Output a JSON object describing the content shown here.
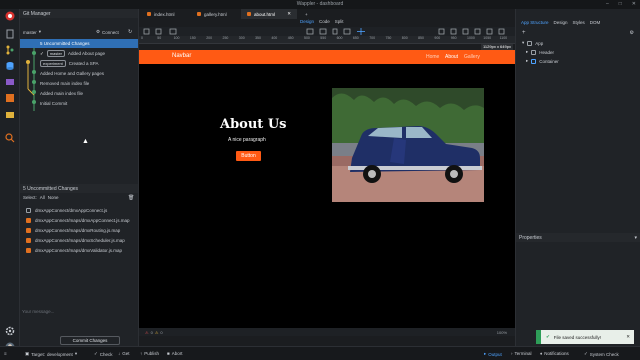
{
  "titlebar": {
    "title": "Wappler - dashboard"
  },
  "git": {
    "panel_title": "Git Manager",
    "branch": "master",
    "connect_label": "Connect",
    "uncommitted_label": "5 Uncommitted Changes",
    "commits": [
      {
        "tag": "master",
        "message": "Added About page"
      },
      {
        "tag": "experiment",
        "message": "Created a SPA"
      },
      {
        "tag": "",
        "message": "Added Home and Gallery pages"
      },
      {
        "tag": "",
        "message": "Removed main index file"
      },
      {
        "tag": "",
        "message": "Added main index file"
      },
      {
        "tag": "",
        "message": "Initial Commit"
      }
    ],
    "changes_title": "5 Uncommitted Changes",
    "select_label": "Select:",
    "select_all": "All",
    "select_none": "None",
    "files": [
      {
        "name": "dmxAppConnect/dmxAppConnect.js",
        "modified": false
      },
      {
        "name": "dmxAppConnect/maps/dmxAppConnect.js.map",
        "modified": true
      },
      {
        "name": "dmxAppConnect/maps/dmxRouting.js.map",
        "modified": true
      },
      {
        "name": "dmxAppConnect/maps/dmxScheduler.js.map",
        "modified": true
      },
      {
        "name": "dmxAppConnect/maps/dmxValidator.js.map",
        "modified": true
      }
    ],
    "message_placeholder": "Your message...",
    "commit_button": "Commit Changes"
  },
  "tabs": [
    {
      "label": "index.html",
      "active": false
    },
    {
      "label": "gallery.html",
      "active": false
    },
    {
      "label": "about.html",
      "active": true
    }
  ],
  "view_modes": [
    {
      "label": "Design",
      "active": true
    },
    {
      "label": "Code",
      "active": false
    },
    {
      "label": "Split",
      "active": false
    }
  ],
  "ruler_ticks": [
    "0",
    "50",
    "100",
    "150",
    "200",
    "250",
    "300",
    "350",
    "400",
    "450",
    "500",
    "550",
    "600",
    "650",
    "700",
    "750",
    "800",
    "850",
    "900",
    "950",
    "1000",
    "1050",
    "1100"
  ],
  "size_badge": "1129px x 649px",
  "page": {
    "brand": "Navbar",
    "nav_links": [
      "Home",
      "About",
      "Gallery"
    ],
    "hero_title": "About Us",
    "hero_paragraph": "A nice paragraph",
    "hero_button": "Button"
  },
  "doc_status": {
    "errors": "0",
    "warnings": "0",
    "zoom": "100%"
  },
  "right": {
    "tabs": [
      "App Structure",
      "Design",
      "Styles",
      "DOM"
    ],
    "tree": [
      {
        "label": "App",
        "level": 0
      },
      {
        "label": "Header",
        "level": 1
      },
      {
        "label": "Container",
        "level": 1
      }
    ],
    "properties_title": "Properties"
  },
  "toast": {
    "message": "File saved successfully!"
  },
  "statusbar": {
    "target_label": "Target:",
    "target_value": "development",
    "actions": [
      "Check",
      "Get",
      "Publish",
      "Abort"
    ],
    "right_items": [
      "Output",
      "Terminal",
      "Notifications",
      "System Check"
    ]
  },
  "colors": {
    "accent": "#ff5a14",
    "link": "#4ea3ff",
    "success": "#2e9d58"
  }
}
